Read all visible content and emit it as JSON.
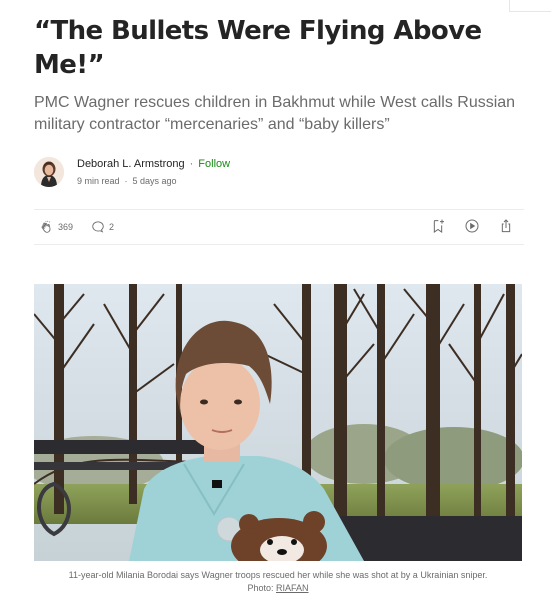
{
  "article": {
    "title": "“The Bullets Were Flying Above Me!”",
    "subtitle": "PMC Wagner rescues children in Bakhmut while West calls Russian military contractor “mercenaries” and “baby killers”",
    "author": "Deborah L. Armstrong",
    "follow_label": "Follow",
    "separator": "·",
    "read_time": "9 min read",
    "published": "5 days ago"
  },
  "actions": {
    "claps": "369",
    "responses": "2",
    "icons": [
      "clap-icon",
      "comment-icon",
      "bookmark-add-icon",
      "play-icon",
      "share-icon"
    ]
  },
  "image": {
    "caption": "11-year-old Milania Borodai says Wagner troops rescued her while she was shot at by a Ukrainian sniper.",
    "photo_credit_prefix": "Photo:",
    "photo_credit_link": "RIAFAN"
  },
  "colors": {
    "text": "#242424",
    "muted": "#6b6b6b",
    "follow_green": "#1a8917",
    "divider": "#ececec"
  }
}
